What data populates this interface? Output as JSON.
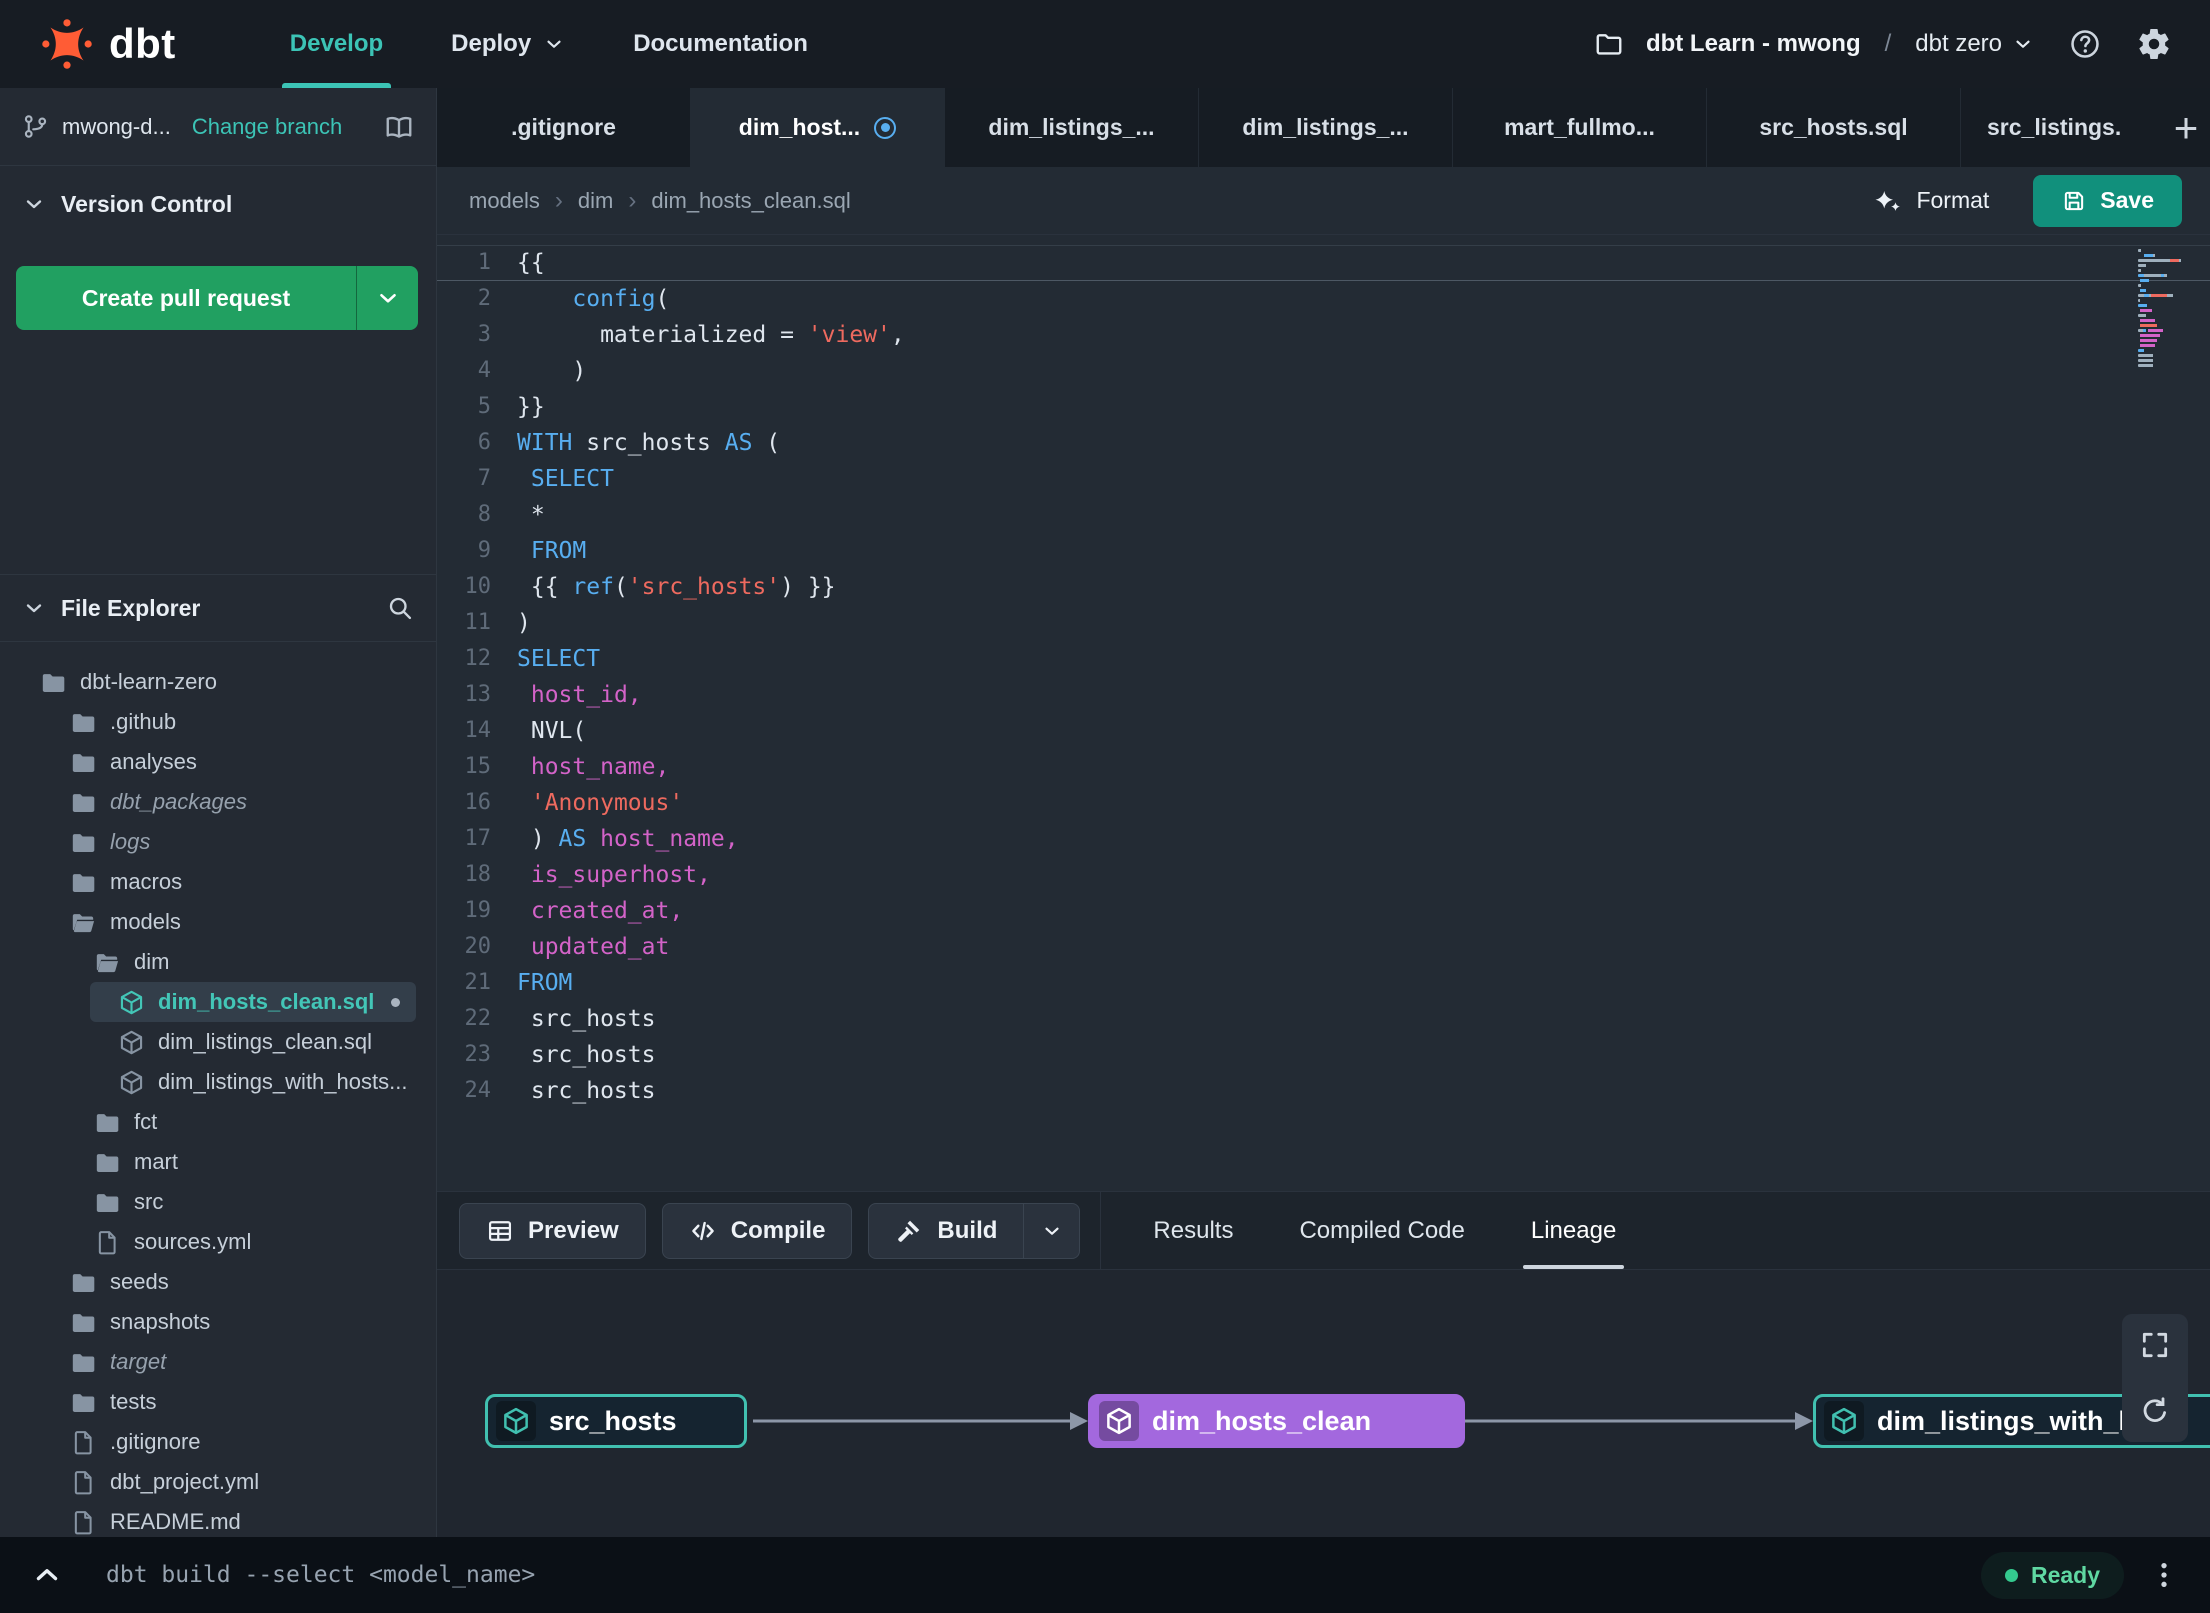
{
  "colors": {
    "accent_teal": "#3cc4b6",
    "brand_orange": "#ff5c35",
    "pr_green": "#21a061",
    "save_teal": "#11907c",
    "node_purple": "#a368de",
    "node_teal_border": "#41c0b0",
    "status_green": "#34c98e",
    "keyword_blue": "#58aef0",
    "string_red": "#ee6a5f",
    "identifier_pink": "#d363c8"
  },
  "navbar": {
    "brand": "dbt",
    "items": [
      {
        "label": "Develop",
        "active": true
      },
      {
        "label": "Deploy",
        "caret": true
      },
      {
        "label": "Documentation"
      }
    ],
    "project": {
      "account": "dbt Learn - mwong",
      "sep": "/",
      "env": "dbt zero"
    }
  },
  "branch_bar": {
    "branch": "mwong-d...",
    "change_link": "Change branch"
  },
  "version_control": {
    "title": "Version Control",
    "create_pr_label": "Create pull request"
  },
  "file_explorer": {
    "title": "File Explorer",
    "tree": [
      {
        "name": "dbt-learn-zero",
        "type": "folder",
        "level": 0
      },
      {
        "name": ".github",
        "type": "folder",
        "level": 1
      },
      {
        "name": "analyses",
        "type": "folder",
        "level": 1
      },
      {
        "name": "dbt_packages",
        "type": "folder",
        "level": 1,
        "italic": true
      },
      {
        "name": "logs",
        "type": "folder",
        "level": 1,
        "italic": true
      },
      {
        "name": "macros",
        "type": "folder",
        "level": 1
      },
      {
        "name": "models",
        "type": "folder-open",
        "level": 1
      },
      {
        "name": "dim",
        "type": "folder-open",
        "level": 2
      },
      {
        "name": "dim_hosts_clean.sql",
        "type": "model",
        "level": 3,
        "selected": true,
        "modified": true
      },
      {
        "name": "dim_listings_clean.sql",
        "type": "model",
        "level": 3
      },
      {
        "name": "dim_listings_with_hosts...",
        "type": "model",
        "level": 3
      },
      {
        "name": "fct",
        "type": "folder",
        "level": 2
      },
      {
        "name": "mart",
        "type": "folder",
        "level": 2
      },
      {
        "name": "src",
        "type": "folder",
        "level": 2
      },
      {
        "name": "sources.yml",
        "type": "file",
        "level": 2
      },
      {
        "name": "seeds",
        "type": "folder",
        "level": 1
      },
      {
        "name": "snapshots",
        "type": "folder",
        "level": 1
      },
      {
        "name": "target",
        "type": "folder",
        "level": 1,
        "italic": true
      },
      {
        "name": "tests",
        "type": "folder",
        "level": 1
      },
      {
        "name": ".gitignore",
        "type": "file",
        "level": 1
      },
      {
        "name": "dbt_project.yml",
        "type": "file",
        "level": 1
      },
      {
        "name": "README.md",
        "type": "file",
        "level": 1
      }
    ]
  },
  "tabbar": {
    "plus": "+",
    "tabs": [
      {
        "label": ".gitignore"
      },
      {
        "label": "dim_host...",
        "active": true,
        "indicator": true
      },
      {
        "label": "dim_listings_..."
      },
      {
        "label": "dim_listings_..."
      },
      {
        "label": "mart_fullmo..."
      },
      {
        "label": "src_hosts.sql"
      },
      {
        "label": "src_listings.",
        "clipped": true
      }
    ]
  },
  "breadcrumb": {
    "items": [
      "models",
      "dim",
      "dim_hosts_clean.sql"
    ]
  },
  "editor_actions": {
    "format_label": "Format",
    "save_label": "Save"
  },
  "code": {
    "lines": [
      [
        [
          "{{",
          "pl"
        ]
      ],
      [
        [
          "    ",
          "pl"
        ],
        [
          "config",
          "fn"
        ],
        [
          "(",
          "pl"
        ]
      ],
      [
        [
          "      materialized = ",
          "pl"
        ],
        [
          "'view'",
          "str"
        ],
        [
          ",",
          "pl"
        ]
      ],
      [
        [
          "    )",
          "pl"
        ]
      ],
      [
        [
          "}}",
          "pl"
        ]
      ],
      [
        [
          "WITH",
          "kw"
        ],
        [
          " src_hosts ",
          "pl"
        ],
        [
          "AS",
          "kw"
        ],
        [
          " (",
          "pl"
        ]
      ],
      [
        [
          " ",
          "pl"
        ],
        [
          "SELECT",
          "kw"
        ]
      ],
      [
        [
          " *",
          "pl"
        ]
      ],
      [
        [
          " ",
          "pl"
        ],
        [
          "FROM",
          "kw"
        ]
      ],
      [
        [
          " {{ ",
          "pl"
        ],
        [
          "ref",
          "fn"
        ],
        [
          "(",
          "pl"
        ],
        [
          "'src_hosts'",
          "str"
        ],
        [
          ") }}",
          "pl"
        ]
      ],
      [
        [
          ")",
          "pl"
        ]
      ],
      [
        [
          "SELECT",
          "kw"
        ]
      ],
      [
        [
          " ",
          "pl"
        ],
        [
          "host_id,",
          "var"
        ]
      ],
      [
        [
          " NVL(",
          "pl"
        ]
      ],
      [
        [
          " ",
          "pl"
        ],
        [
          "host_name,",
          "var"
        ]
      ],
      [
        [
          " ",
          "pl"
        ],
        [
          "'Anonymous'",
          "str"
        ]
      ],
      [
        [
          " ) ",
          "pl"
        ],
        [
          "AS",
          "kw"
        ],
        [
          " ",
          "pl"
        ],
        [
          "host_name,",
          "var"
        ]
      ],
      [
        [
          " ",
          "pl"
        ],
        [
          "is_superhost,",
          "var"
        ]
      ],
      [
        [
          " ",
          "pl"
        ],
        [
          "created_at,",
          "var"
        ]
      ],
      [
        [
          " ",
          "pl"
        ],
        [
          "updated_at",
          "var"
        ]
      ],
      [
        [
          "FROM",
          "kw"
        ]
      ],
      [
        [
          " src_hosts",
          "pl"
        ]
      ],
      [
        [
          " src_hosts",
          "pl"
        ]
      ],
      [
        [
          " src_hosts",
          "pl"
        ]
      ]
    ]
  },
  "bottom_panel": {
    "run_buttons": [
      {
        "label": "Preview",
        "icon": "table-icon"
      },
      {
        "label": "Compile",
        "icon": "code-icon"
      },
      {
        "label": "Build",
        "icon": "hammer-icon",
        "split": true
      }
    ],
    "tabs": [
      {
        "label": "Results"
      },
      {
        "label": "Compiled Code"
      },
      {
        "label": "Lineage",
        "active": true
      }
    ]
  },
  "lineage": {
    "nodes": [
      {
        "label": "src_hosts",
        "variant": "source"
      },
      {
        "label": "dim_hosts_clean",
        "variant": "model"
      },
      {
        "label": "dim_listings_with_h",
        "variant": "source"
      }
    ]
  },
  "command_bar": {
    "command": "dbt build --select <model_name>",
    "status": "Ready"
  }
}
